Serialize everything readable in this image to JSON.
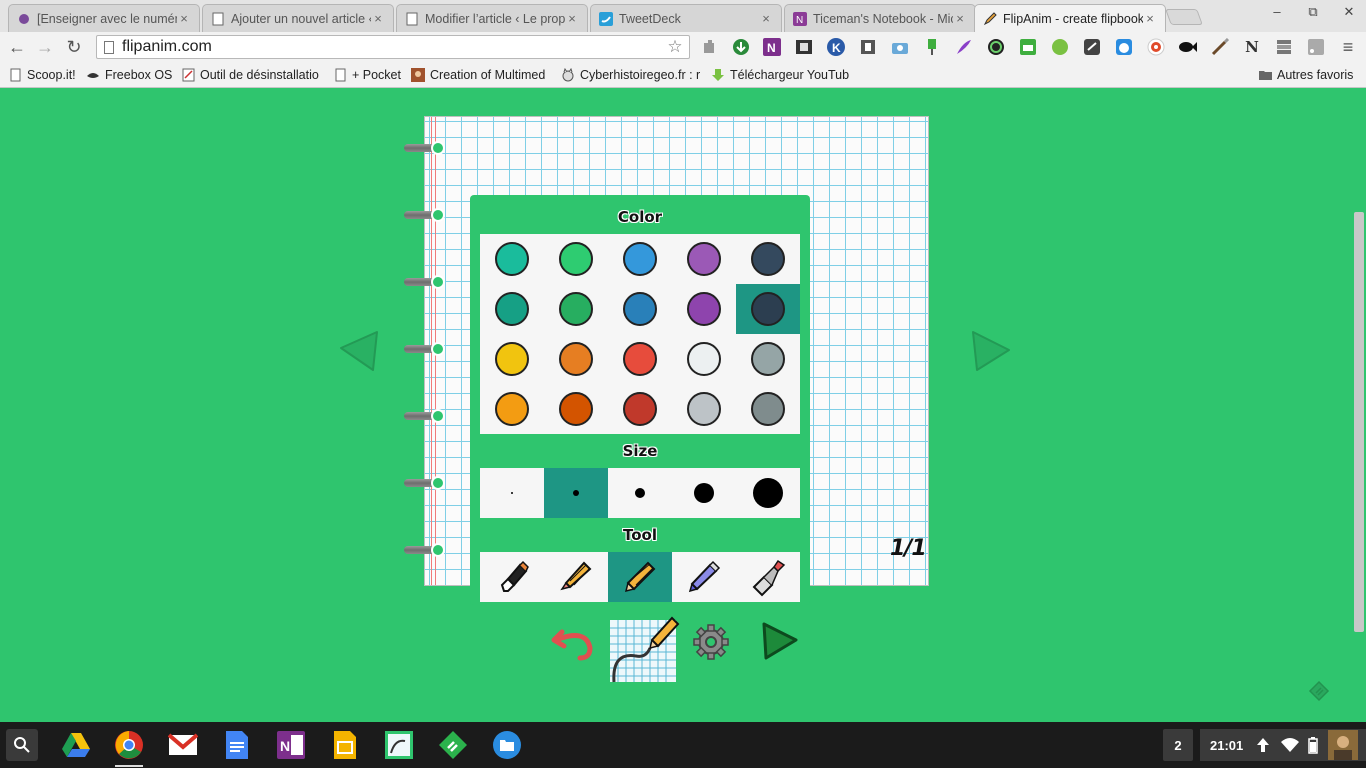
{
  "browser": {
    "tabs": [
      {
        "title": "[Enseigner avec le numéri",
        "icon": "bird-icon",
        "active": false
      },
      {
        "title": "Ajouter un nouvel article ‹",
        "icon": "page-icon",
        "active": false
      },
      {
        "title": "Modifier l’article ‹ Le prop",
        "icon": "page-icon",
        "active": false
      },
      {
        "title": "TweetDeck",
        "icon": "twitter-icon",
        "active": false
      },
      {
        "title": "Ticeman's Notebook - Mic",
        "icon": "onenote-icon",
        "active": false
      },
      {
        "title": "FlipAnim - create flipbook",
        "icon": "pencil-icon",
        "active": true
      }
    ],
    "tab_close_glyph": "×",
    "window_controls": {
      "minimize": "–",
      "restore": "⧉",
      "close": "✕"
    },
    "nav": {
      "back": "←",
      "forward": "→",
      "reload": "↻"
    },
    "url": "flipanim.com",
    "star_glyph": "☆",
    "menu_glyph": "≡",
    "extensions": [
      "puzzle-icon",
      "download-icon",
      "onenote-icon",
      "film-icon",
      "klout-icon",
      "bookmark-icon",
      "camera-icon",
      "pin-icon",
      "feather-icon",
      "color-wheel-icon",
      "printer-icon",
      "green-dot-icon",
      "chat-icon",
      "bear-icon",
      "target-icon",
      "fish-icon",
      "brush-icon",
      "notion-icon",
      "stack-icon",
      "rss-icon"
    ],
    "extension_glyphs": {
      "klout": "K",
      "notion": "N"
    },
    "bookmarks": [
      {
        "label": "Scoop.it!",
        "icon": "page-icon"
      },
      {
        "label": "Freebox OS",
        "icon": "freebox-icon"
      },
      {
        "label": "Outil de désinstallatio",
        "icon": "tool-icon"
      },
      {
        "label": "+ Pocket",
        "icon": "page-icon"
      },
      {
        "label": "Creation of Multimed",
        "icon": "avatar-icon"
      },
      {
        "label": "Cyberhistoiregeo.fr : r",
        "icon": "cat-icon"
      },
      {
        "label": "Téléchargeur YouTub",
        "icon": "download-green-icon"
      }
    ],
    "other_bookmarks": "Autres favoris"
  },
  "app": {
    "page_counter": "1/1",
    "panel": {
      "color_title": "Color",
      "size_title": "Size",
      "tool_title": "Tool",
      "colors": [
        [
          "#1abc9c",
          "#2ecc71",
          "#3498db",
          "#9b59b6",
          "#34495e"
        ],
        [
          "#16a085",
          "#27ae60",
          "#2980b9",
          "#8e44ad",
          "#2c3e50"
        ],
        [
          "#f1c40f",
          "#e67e22",
          "#e74c3c",
          "#ecf0f1",
          "#95a5a6"
        ],
        [
          "#f39c12",
          "#d35400",
          "#c0392b",
          "#bdc3c7",
          "#7f8c8d"
        ]
      ],
      "selected_color": {
        "row": 1,
        "col": 4
      },
      "sizes": [
        1,
        2,
        3,
        4,
        5
      ],
      "selected_size": 1,
      "tools": [
        "marker-icon",
        "pencil-eraser-icon",
        "pencil-icon",
        "highlighter-icon",
        "roller-icon"
      ],
      "selected_tool": 2
    },
    "controls": [
      "undo-icon",
      "pencil-grid-icon",
      "settings-gear-icon",
      "play-triangle-icon"
    ]
  },
  "shelf": {
    "apps": [
      "google-drive-icon",
      "chrome-icon",
      "gmail-icon",
      "google-docs-icon",
      "onenote-icon",
      "google-slides-icon",
      "flipanim-icon",
      "feedly-icon",
      "files-icon"
    ],
    "active_app": "chrome-icon",
    "notification_count": "2",
    "clock": "21:01"
  },
  "colors": {
    "page_background": "#2fc56e",
    "selection": "#1e9684"
  }
}
